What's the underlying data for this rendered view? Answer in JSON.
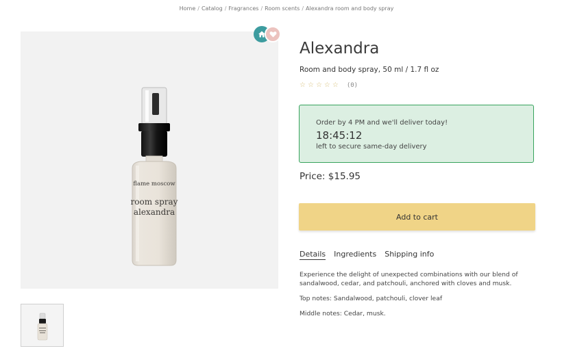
{
  "breadcrumb": {
    "items": [
      "Home",
      "Catalog",
      "Fragrances",
      "Room scents",
      "Alexandra room and body spray"
    ],
    "separator": "/"
  },
  "gallery": {
    "bottle_label_brand": "flame moscow",
    "bottle_label_line1": "room spray",
    "bottle_label_line2": "alexandra",
    "badges": [
      "home-icon",
      "heart-icon"
    ]
  },
  "product": {
    "title": "Alexandra",
    "subtitle": "Room and body spray, 50 ml / 1.7 fl oz",
    "rating_stars": 0,
    "rating_max": 5,
    "rating_count": "(0)",
    "price": "Price: $15.95"
  },
  "delivery": {
    "line1": "Order by 4 PM and we'll deliver today!",
    "timer": "18:45:12",
    "line3": "left to secure same-day delivery"
  },
  "cart": {
    "button_label": "Add to cart"
  },
  "tabs": [
    {
      "label": "Details",
      "active": true
    },
    {
      "label": "Ingredients",
      "active": false
    },
    {
      "label": "Shipping info",
      "active": false
    }
  ],
  "details": {
    "description": "Experience the delight of unexpected combinations with our blend of sandalwood, cedar, and patchouli, anchored with cloves and musk.",
    "top_notes": "Top notes: Sandalwood, patchouli, clover leaf",
    "middle_notes": "Middle notes: Cedar, musk."
  },
  "colors": {
    "accent_button": "#f0d487",
    "delivery_bg": "#dcefe2",
    "delivery_border": "#36a35c",
    "badge_home": "#3d9c9f",
    "badge_fav": "#ecc3bf"
  }
}
